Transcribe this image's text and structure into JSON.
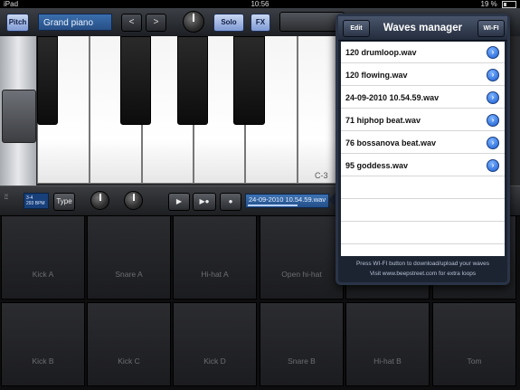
{
  "status_bar": {
    "device": "iPad",
    "time": "10:56",
    "battery": "19 %"
  },
  "topbar": {
    "pitch_label": "Pitch",
    "preset_name": "Grand piano",
    "prev_label": "<",
    "next_label": ">",
    "solo_label": "Solo",
    "fx_label": "FX"
  },
  "keyboard": {
    "key_label": "C-3"
  },
  "controlbar": {
    "tempo_line1": "3-4",
    "tempo_line2": "293 BPM",
    "type_label": "Type",
    "play_icon": "play-icon",
    "record_play_icon": "record-play-icon",
    "record_icon": "record-icon",
    "recording_name": "24-09-2010 10.54.59.wav"
  },
  "pads": {
    "row1": [
      "Kick A",
      "Snare A",
      "Hi-hat A",
      "Open hi-hat",
      "",
      ""
    ],
    "row2": [
      "Kick B",
      "Kick C",
      "Kick D",
      "Snare B",
      "Hi-hat B",
      "Tom"
    ]
  },
  "waves_manager": {
    "title": "Waves manager",
    "edit_label": "Edit",
    "wifi_label": "WI-FI",
    "files": [
      "120 drumloop.wav",
      "120 flowing.wav",
      "24-09-2010 10.54.59.wav",
      "71 hiphop beat.wav",
      "76 bossanova beat.wav",
      "95 goddess.wav"
    ],
    "footer_line1": "Press WI-FI button to download/upload your waves",
    "footer_line2": "Visit www.beepstreet.com for extra loops"
  },
  "colors": {
    "accent_blue": "#274f85",
    "popover_bg": "#1c2432",
    "disclosure": "#1c5ed1"
  }
}
